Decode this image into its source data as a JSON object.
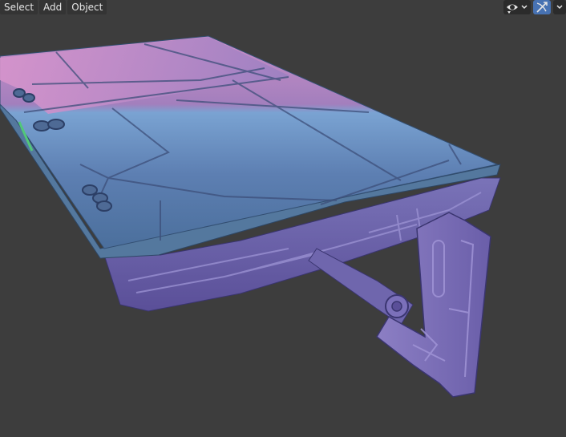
{
  "header": {
    "menu": [
      {
        "label": "Select"
      },
      {
        "label": "Add"
      },
      {
        "label": "Object"
      }
    ],
    "right_tools": [
      {
        "icon": "eye-visibility-icon",
        "has_dropdown": true
      },
      {
        "icon": "gizmo-transform-icon",
        "has_dropdown": true,
        "active": true
      }
    ]
  },
  "viewport": {
    "background": "#3d3d3d",
    "object": "sci-fi table with folding support leg",
    "shading": "normal-map matcap (pink / blue / purple)"
  },
  "colors": {
    "header_button_bg": "#343434",
    "header_text": "#e6e6e6",
    "active_tool": "#4772b3"
  }
}
